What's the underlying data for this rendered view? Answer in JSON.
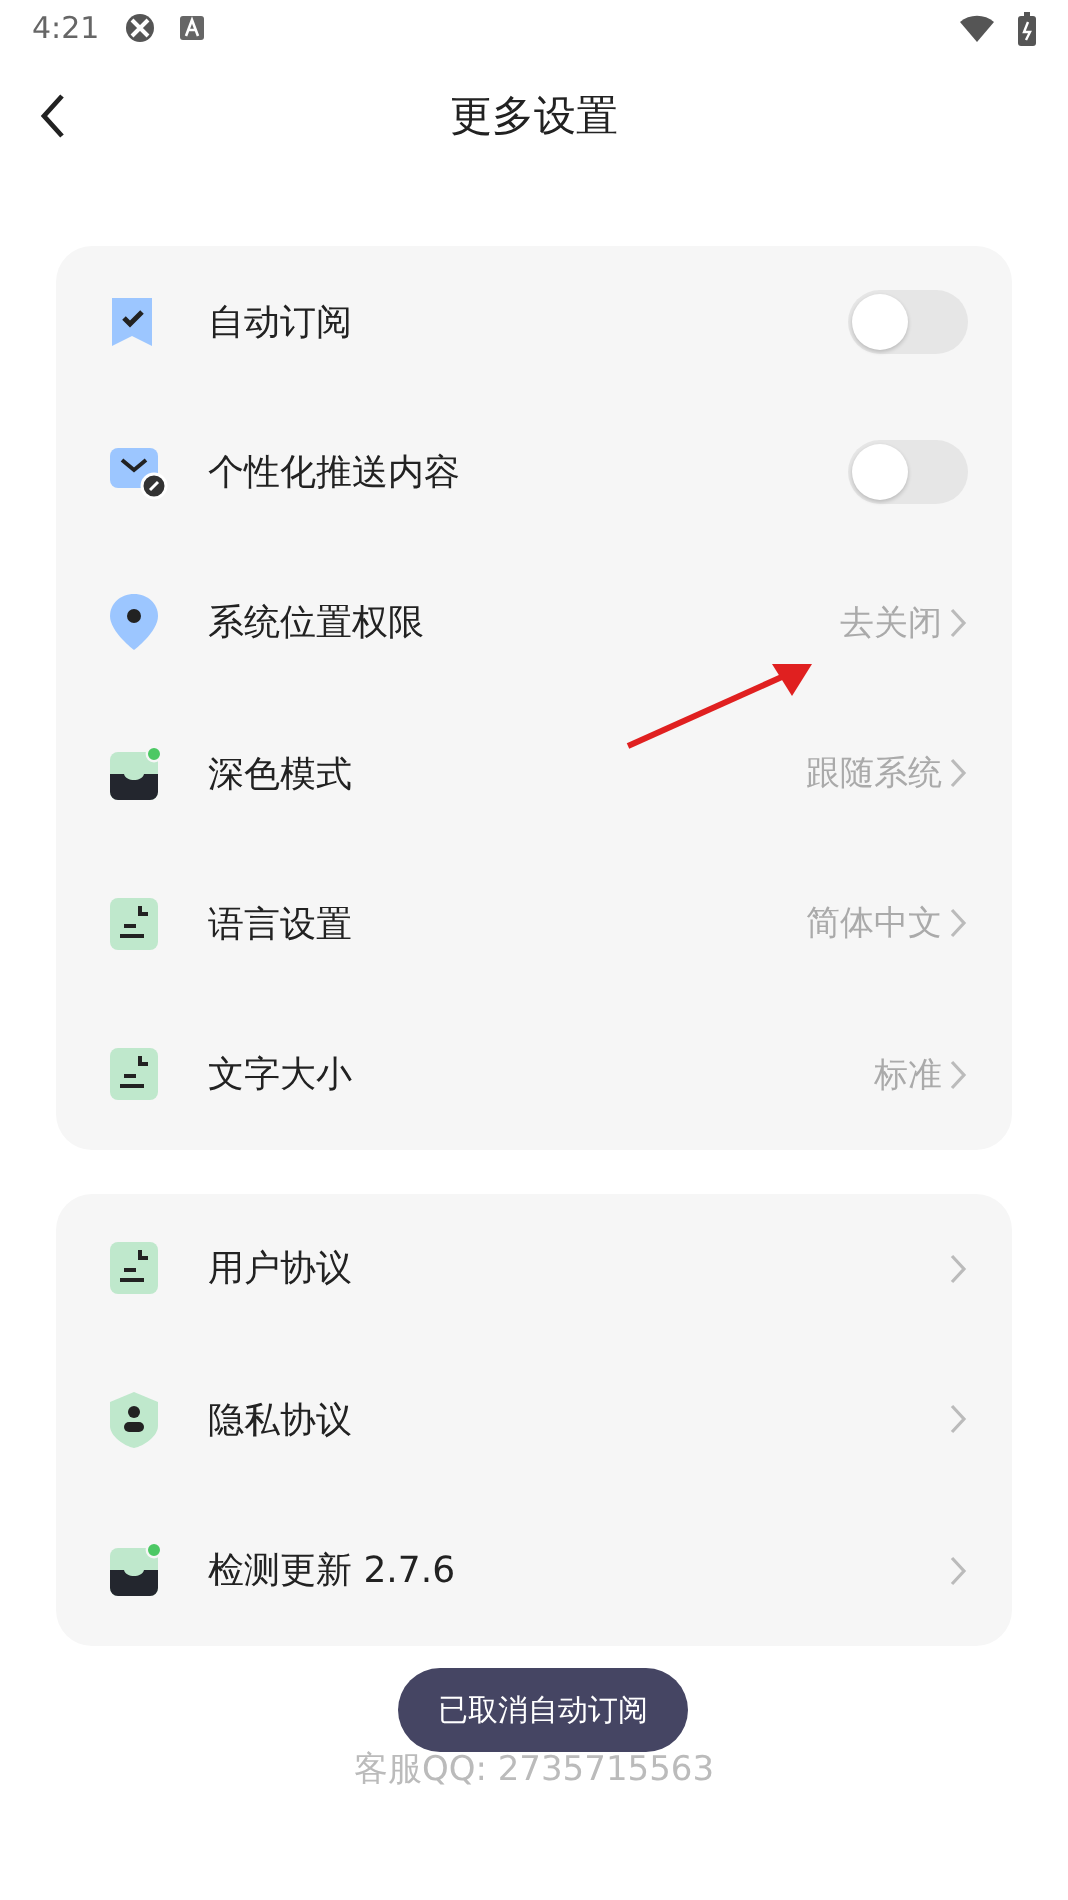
{
  "status_bar": {
    "time": "4:21"
  },
  "header": {
    "title": "更多设置"
  },
  "groups": [
    {
      "items": [
        {
          "label": "自动订阅",
          "kind": "toggle",
          "on": false
        },
        {
          "label": "个性化推送内容",
          "kind": "toggle",
          "on": false
        },
        {
          "label": "系统位置权限",
          "kind": "link",
          "value": "去关闭"
        },
        {
          "label": "深色模式",
          "kind": "link",
          "value": "跟随系统"
        },
        {
          "label": "语言设置",
          "kind": "link",
          "value": "简体中文"
        },
        {
          "label": "文字大小",
          "kind": "link",
          "value": "标准"
        }
      ]
    },
    {
      "items": [
        {
          "label": "用户协议",
          "kind": "link"
        },
        {
          "label": "隐私协议",
          "kind": "link"
        },
        {
          "label": "检测更新 2.7.6",
          "kind": "link"
        }
      ]
    }
  ],
  "footer": {
    "text": "客服QQ: 2735715563"
  },
  "toast": {
    "text": "已取消自动订阅"
  }
}
